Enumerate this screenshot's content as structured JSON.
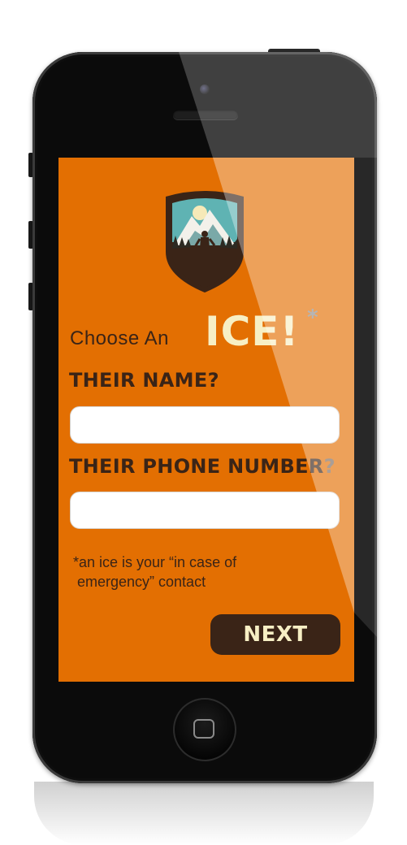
{
  "screen": {
    "headline_prefix": "Choose An",
    "headline_highlight": "ICE!",
    "headline_asterisk": "*",
    "name_label": "THEIR NAME",
    "name_label_q": "?",
    "name_value": "",
    "phone_label": "THEIR PHONE NUMBER",
    "phone_label_q": "?",
    "phone_value": "",
    "footnote_line1": "*an ice is your “in case of",
    "footnote_line2": " emergency” contact",
    "next_label": "NEXT"
  },
  "colors": {
    "screen_bg": "#e36f02",
    "dark_brown": "#3a2417",
    "cream": "#f7efc4",
    "input_bg": "#ffffff"
  },
  "icons": {
    "logo": "mountain-hiker-badge-icon",
    "home": "home-button-icon"
  }
}
